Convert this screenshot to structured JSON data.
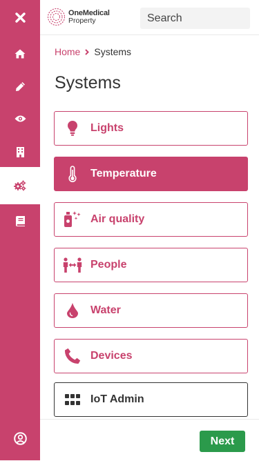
{
  "app": {
    "logo_line1": "OneMedical",
    "logo_line2": "Property"
  },
  "search": {
    "placeholder": "Search"
  },
  "sidebar": {
    "items": [
      {
        "icon": "close-icon"
      },
      {
        "icon": "home-icon"
      },
      {
        "icon": "pencil-icon"
      },
      {
        "icon": "eye-icon"
      },
      {
        "icon": "building-icon"
      },
      {
        "icon": "gears-icon",
        "active": true
      },
      {
        "icon": "book-icon"
      },
      {
        "icon": "user-circle-icon"
      }
    ]
  },
  "breadcrumb": {
    "home": "Home",
    "current": "Systems"
  },
  "page": {
    "title": "Systems"
  },
  "systems": [
    {
      "label": "Lights",
      "icon": "lightbulb-icon"
    },
    {
      "label": "Temperature",
      "icon": "thermometer-icon",
      "selected": true
    },
    {
      "label": "Air quality",
      "icon": "spray-icon"
    },
    {
      "label": "People",
      "icon": "people-arrows-icon"
    },
    {
      "label": "Water",
      "icon": "tint-icon"
    },
    {
      "label": "Devices",
      "icon": "phone-icon"
    },
    {
      "label": "IoT Admin",
      "icon": "grid-icon"
    }
  ],
  "footer": {
    "next_label": "Next"
  },
  "colors": {
    "brand": "#c8426d",
    "success": "#2b9a4b",
    "text": "#333333"
  }
}
